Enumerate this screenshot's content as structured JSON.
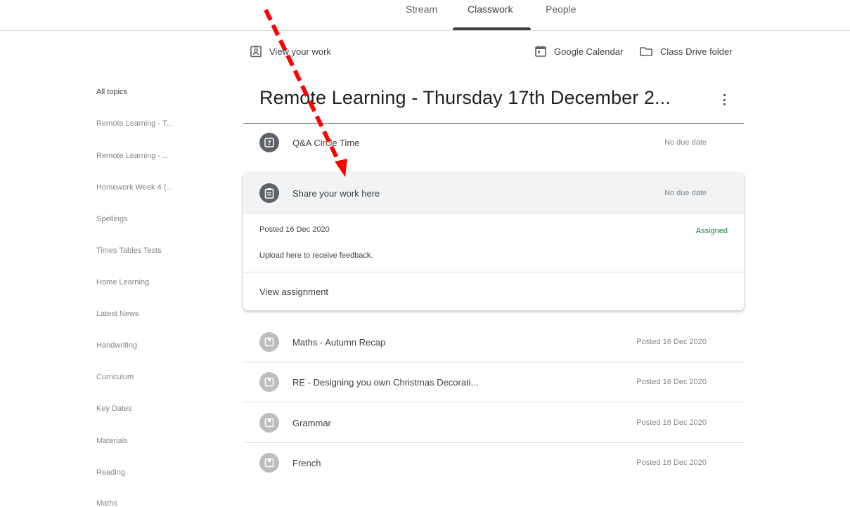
{
  "nav": {
    "tabs": [
      {
        "label": "Stream"
      },
      {
        "label": "Classwork",
        "active": true
      },
      {
        "label": "People"
      }
    ]
  },
  "toolbar": {
    "view_work": {
      "label": "View your work",
      "icon": "assignment-ind-icon"
    },
    "calendar": {
      "label": "Google Calendar",
      "icon": "calendar-icon"
    },
    "drive": {
      "label": "Class Drive folder",
      "icon": "folder-icon"
    }
  },
  "sidebar": {
    "items": [
      {
        "label": "All topics",
        "active": true
      },
      {
        "label": "Remote Learning - T..."
      },
      {
        "label": "Remote Learning - ..."
      },
      {
        "label": "Homework Week 4 (..."
      },
      {
        "label": "Spellings"
      },
      {
        "label": "Times Tables Tests"
      },
      {
        "label": "Home Learning"
      },
      {
        "label": "Latest News"
      },
      {
        "label": "Handwriting"
      },
      {
        "label": "Curriculum"
      },
      {
        "label": "Key Dates"
      },
      {
        "label": "Materials"
      },
      {
        "label": "Reading"
      },
      {
        "label": "Maths"
      }
    ]
  },
  "topic": {
    "title": "Remote Learning - Thursday 17th December 2..."
  },
  "items": [
    {
      "title": "Q&A Circle Time",
      "meta": "No due date",
      "icon": "question-icon"
    },
    {
      "title": "Maths - Autumn Recap",
      "meta": "Posted 16 Dec 2020",
      "icon": "material-icon"
    },
    {
      "title": "RE - Designing you own Christmas Decorati...",
      "meta": "Posted 16 Dec 2020",
      "icon": "material-icon"
    },
    {
      "title": "Grammar",
      "meta": "Posted 16 Dec 2020",
      "icon": "material-icon"
    },
    {
      "title": "French",
      "meta": "Posted 16 Dec 2020",
      "icon": "material-icon"
    }
  ],
  "expanded": {
    "title": "Share your work here",
    "due": "No due date",
    "posted": "Posted 16 Dec 2020",
    "status": "Assigned",
    "instructions": "Upload here to receive feedback.",
    "view_label": "View assignment",
    "icon": "assignment-icon"
  },
  "colors": {
    "status_assigned": "#188038",
    "annotation_arrow": "#ff0000",
    "icon_active": "#5f6368",
    "icon_material": "#bdbdbd"
  }
}
